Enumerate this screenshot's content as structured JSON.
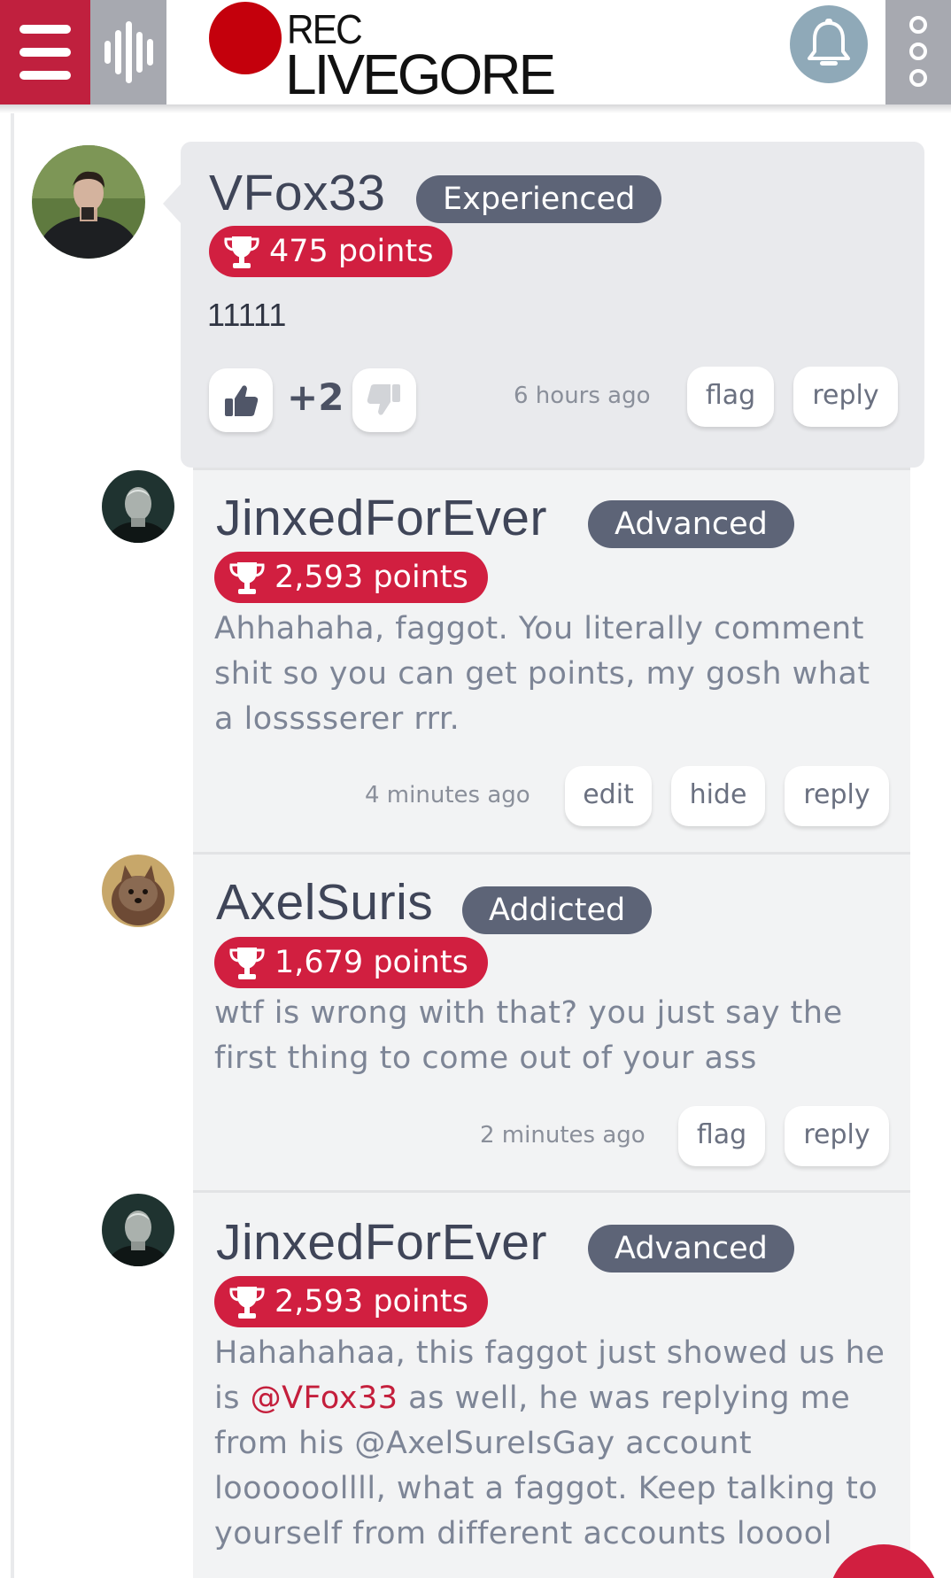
{
  "brand": {
    "rec_label": "REC",
    "site_name": "LIVEGORE",
    "primary_color": "#c0203e",
    "badge_red": "#d11f40",
    "rank_gray": "#5d6477"
  },
  "icons": {
    "menu": "hamburger-icon",
    "activity": "soundwave-icon",
    "notifications": "bell-icon",
    "more": "vertical-dots-icon",
    "points": "trophy-icon",
    "upvote": "thumbs-up-icon",
    "downvote": "thumbs-down-icon"
  },
  "comments": [
    {
      "username": "VFox33",
      "rank": "Experienced",
      "points": "475 points",
      "body": "11111",
      "score": "+2",
      "time": "6 hours ago",
      "actions": [
        "flag",
        "reply"
      ]
    },
    {
      "username": "JinxedForEver",
      "rank": "Advanced",
      "points": "2,593 points",
      "body": "Ahhahaha, faggot. You literally comment shit so you can get points, my gosh what a losssserer rrr.",
      "time": "4 minutes ago",
      "actions": [
        "edit",
        "hide",
        "reply"
      ]
    },
    {
      "username": "AxelSuris",
      "rank": "Addicted",
      "points": "1,679 points",
      "body": "wtf is wrong with that? you just say the first thing to come out of your ass",
      "time": "2 minutes ago",
      "actions": [
        "flag",
        "reply"
      ]
    },
    {
      "username": "JinxedForEver",
      "rank": "Advanced",
      "points": "2,593 points",
      "body_before": "Hahahahaa, this faggot just showed us he is",
      "mention": "@VFox33",
      "body_after": "as well, he was replying me from his @AxelSureIsGay account loooooollll, what a faggot. Keep talking to yourself from different accounts looool"
    }
  ]
}
